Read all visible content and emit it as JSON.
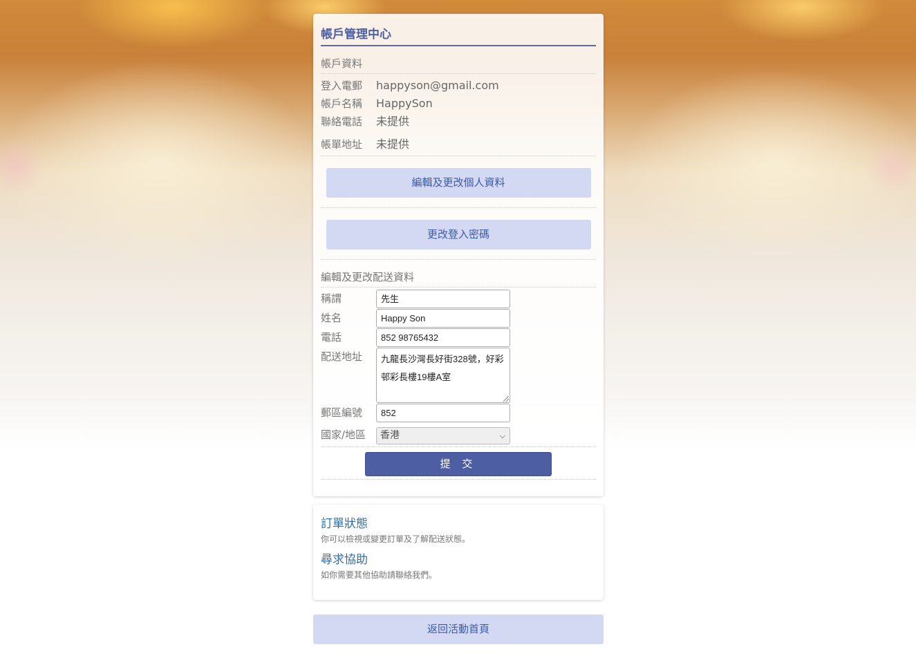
{
  "account": {
    "title": "帳戶管理中心",
    "section_info": "帳戶資料",
    "rows": [
      {
        "label": "登入電郵",
        "value": "happyson@gmail.com"
      },
      {
        "label": "帳戶名稱",
        "value": "HappySon"
      },
      {
        "label": "聯絡電話",
        "value": "未提供"
      },
      {
        "label": "帳單地址",
        "value": "未提供"
      }
    ],
    "edit_profile_button": "編輯及更改個人資料",
    "change_password_button": "更改登入密碼"
  },
  "shipping": {
    "section_label": "編輯及更改配送資料",
    "title_label": "稱謂",
    "title_value": "先生",
    "name_label": "姓名",
    "name_value": "Happy Son",
    "phone_label": "電話",
    "phone_value": "852 98765432",
    "address_label": "配送地址",
    "address_value": "九龍長沙灣長好街328號，好彩邨彩長樓19樓A室",
    "postcode_label": "郵區編號",
    "postcode_value": "852",
    "country_label": "國家/地區",
    "country_value": "香港",
    "submit_button": "提 交"
  },
  "info": {
    "order_heading": "訂單狀態",
    "order_text": "你可以檢視或變更訂單及了解配送狀態。",
    "help_heading": "尋求協助",
    "help_text": "如你需要其他協助請聯絡我們。"
  },
  "back_button": "返回活動首頁",
  "icons": {
    "select_arrow": "chevron-down-icon",
    "textarea_resize": "resize-grip-icon"
  },
  "colors": {
    "accent": "#4e5ea3",
    "light_button": "#d4d9f3",
    "link": "#2f6fae"
  }
}
